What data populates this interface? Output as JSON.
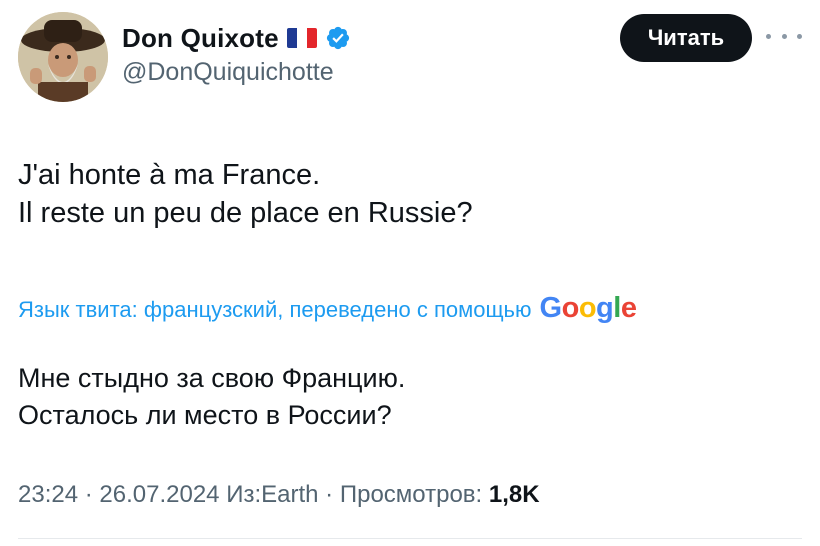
{
  "author": {
    "display_name": "Don Quixote",
    "handle": "@DonQuiquichotte",
    "flag_icon": "france-flag-icon",
    "verified_icon": "verified-badge-icon"
  },
  "header": {
    "follow_label": "Читать",
    "more_icon": "more-options-icon"
  },
  "tweet": {
    "lines": [
      "J'ai honte à ma France.",
      "Il reste un peu de place en Russie?"
    ],
    "translation_note": "Язык твита: французский, переведено с помощью",
    "translation_provider": "Google",
    "translated_lines": [
      "Мне стыдно за свою Францию.",
      "Осталось ли место в России?"
    ]
  },
  "meta": {
    "time": "23:24",
    "date": "26.07.2024",
    "source": "Из:Earth",
    "views_label": "Просмотров:",
    "views_count": "1,8K"
  },
  "colors": {
    "text": "#0f1419",
    "secondary": "#536471",
    "link": "#1d9bf0",
    "verified": "#1d9bf0",
    "button_bg": "#0f1419"
  }
}
